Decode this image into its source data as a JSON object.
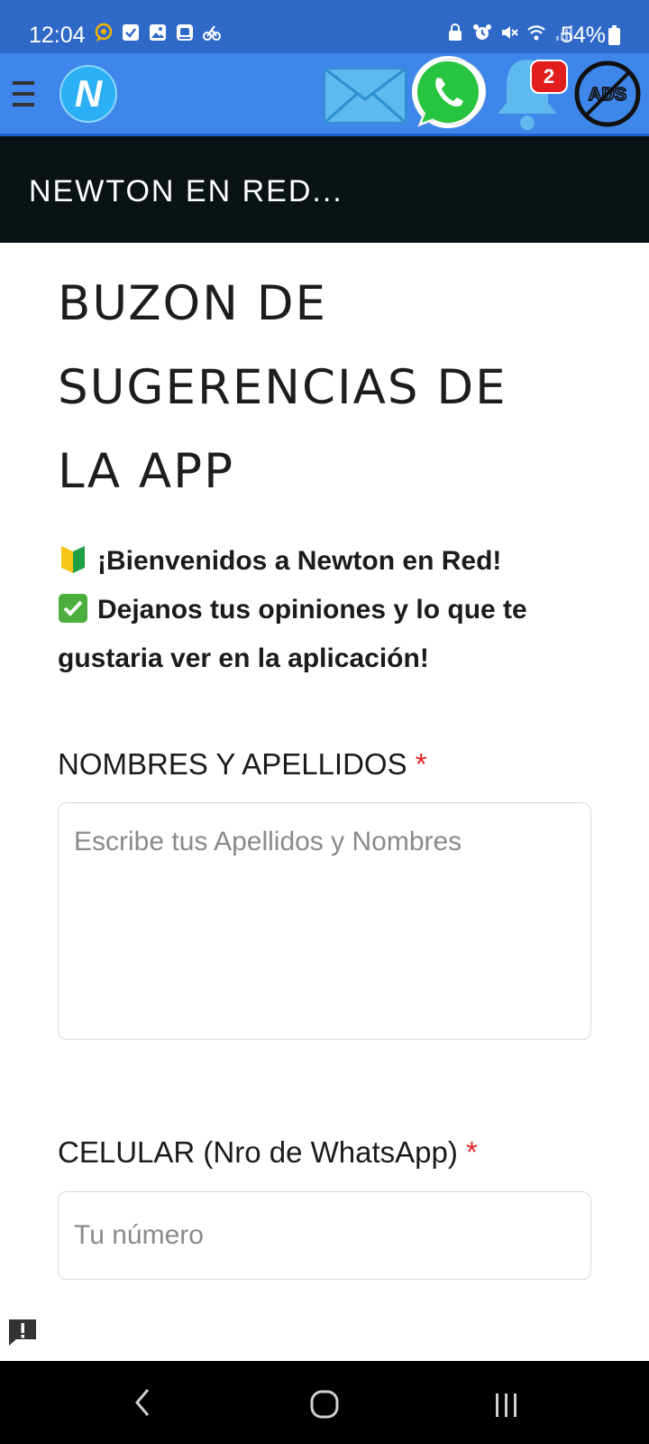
{
  "status_bar": {
    "time": "12:04",
    "battery": "54%",
    "left_icons": [
      "chat-bubble-icon",
      "checkbox-icon",
      "gallery-icon",
      "app-icon",
      "cycle-icon"
    ],
    "right_icons": [
      "vpn-icon",
      "alarm-icon",
      "mute-icon",
      "wifi-icon",
      "signal-icon"
    ]
  },
  "app_bar": {
    "notification_count": "2",
    "logo_letter": "N",
    "ads_label": "ADS",
    "colors": {
      "background": "#3e86ea",
      "badge": "#e21d1d"
    }
  },
  "title_bar": {
    "title": "NEWTON EN RED..."
  },
  "content": {
    "heading_lines": [
      "BUZON DE",
      "SUGERENCIAS DE",
      "LA APP"
    ],
    "intro_line1": "¡Bienvenidos a Newton en Red!",
    "intro_line2": "Dejanos tus opiniones y lo que te gustaria ver en la aplicación!",
    "name_label": "NOMBRES Y APELLIDOS",
    "name_placeholder": "Escribe tus Apellidos y Nombres",
    "cel_label": "CELULAR (Nro de WhatsApp)",
    "cel_placeholder": "Tu número",
    "required_mark": "*"
  }
}
